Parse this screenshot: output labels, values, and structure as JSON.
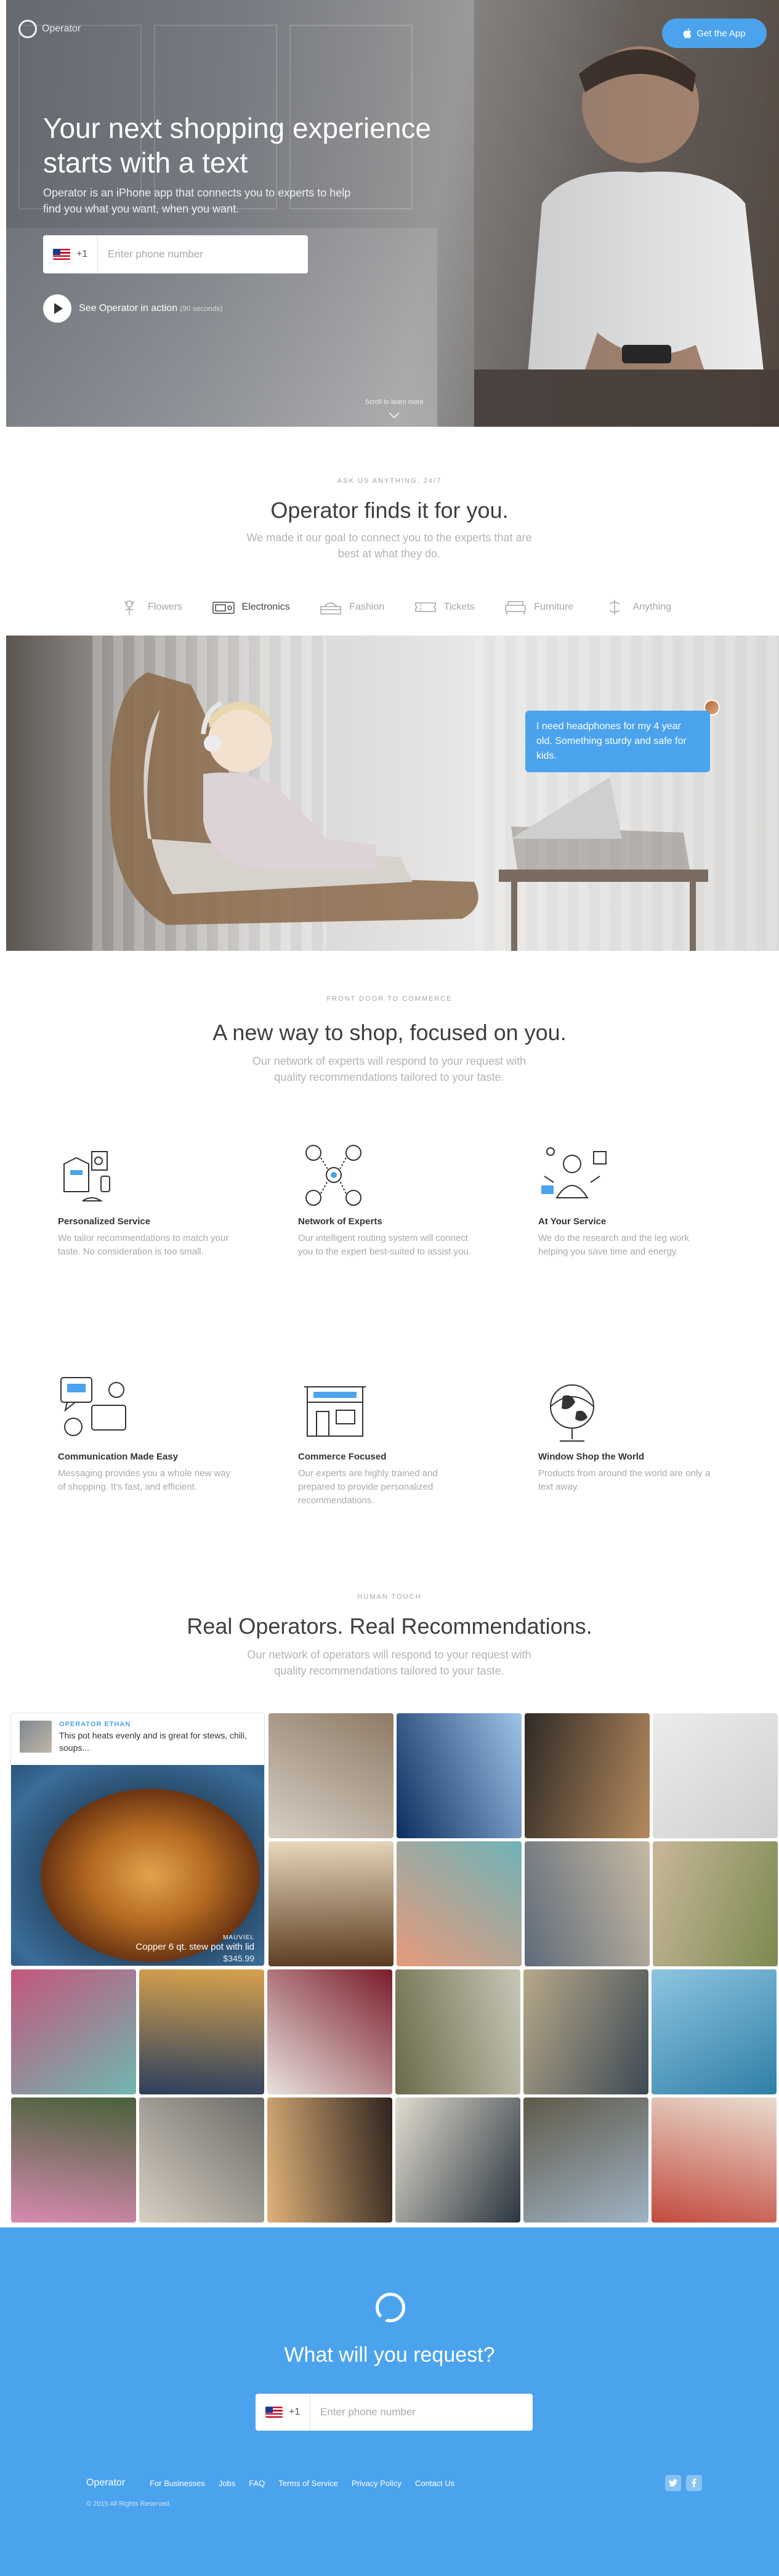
{
  "header": {
    "logo_text": "Operator",
    "get_app_label": "Get the App"
  },
  "hero": {
    "title": "Your next shopping experience starts with a text",
    "subtitle": "Operator is an iPhone app that connects you to experts to help find you what you want, when you want.",
    "country_code": "+1",
    "phone_placeholder": "Enter phone number",
    "video_label": "See Operator in action",
    "video_duration": "(90 seconds)",
    "scroll_label": "Scroll to learn more"
  },
  "finds": {
    "eyebrow": "ASK US ANYTHING, 24/7",
    "title": "Operator finds it for you.",
    "subtitle": "We made it our goal to connect you to the experts that are best at what they do.",
    "categories": [
      {
        "label": "Flowers",
        "icon": "flowers-icon",
        "active": false
      },
      {
        "label": "Electronics",
        "icon": "electronics-icon",
        "active": true
      },
      {
        "label": "Fashion",
        "icon": "fashion-icon",
        "active": false
      },
      {
        "label": "Tickets",
        "icon": "tickets-icon",
        "active": false
      },
      {
        "label": "Furniture",
        "icon": "furniture-icon",
        "active": false
      },
      {
        "label": "Anything",
        "icon": "anything-icon",
        "active": false
      }
    ],
    "chat_message": "I need headphones for my 4 year old. Something sturdy and safe for kids."
  },
  "features": {
    "eyebrow": "FRONT DOOR TO COMMERCE",
    "title": "A new way to shop, focused on you.",
    "subtitle": "Our network of experts will respond to your request with quality recommendations tailored to your taste.",
    "items": [
      {
        "title": "Personalized Service",
        "body": "We tailor recommendations to match your taste. No consideration is too small.",
        "icon": "personalized-service-icon"
      },
      {
        "title": "Network of Experts",
        "body": "Our intelligent routing system will connect you to the expert best-suited to assist you.",
        "icon": "network-of-experts-icon"
      },
      {
        "title": "At Your Service",
        "body": "We do the research and the leg work helping you save time and energy.",
        "icon": "at-your-service-icon"
      },
      {
        "title": "Communication Made Easy",
        "body": "Messaging provides you a whole new way of shopping. It's fast, and efficient.",
        "icon": "communication-icon"
      },
      {
        "title": "Commerce Focused",
        "body": "Our experts are highly trained and prepared to provide personalized recommendations.",
        "icon": "commerce-focused-icon"
      },
      {
        "title": "Window Shop the World",
        "body": "Products from around the world are only a text away.",
        "icon": "globe-icon"
      }
    ]
  },
  "operators": {
    "eyebrow": "HUMAN TOUCH",
    "title": "Real Operators. Real Recommendations.",
    "subtitle": "Our network of operators will respond to your request with quality recommendations tailored to your taste.",
    "card": {
      "operator_name": "OPERATOR ETHAN",
      "quote": "This pot heats evenly and is great for stews, chili, soups...",
      "brand": "MAUVIEL",
      "product": "Copper 6 qt. stew pot with lid",
      "price": "$345.99"
    },
    "tiles": [
      {
        "colors": [
          "#d7cfc4",
          "#8d7a66"
        ]
      },
      {
        "colors": [
          "#0c2e5e",
          "#9ec3e8"
        ]
      },
      {
        "colors": [
          "#2f2a26",
          "#b58a5e"
        ]
      },
      {
        "colors": [
          "#ececec",
          "#cfcfcf"
        ]
      },
      {
        "colors": [
          "#e8d9bd",
          "#5b3a1e"
        ]
      },
      {
        "colors": [
          "#6fb3b8",
          "#e79a7b"
        ]
      },
      {
        "colors": [
          "#c7b9a3",
          "#5e6b7a"
        ]
      },
      {
        "colors": [
          "#7c8a4f",
          "#c8b79a"
        ]
      },
      {
        "colors": [
          "#6fb7b0",
          "#c4567d"
        ]
      },
      {
        "colors": [
          "#2c3f5e",
          "#d6a24c"
        ]
      },
      {
        "colors": [
          "#e8e2de",
          "#7b1d2a"
        ]
      },
      {
        "colors": [
          "#6b6a4a",
          "#c7c7b7"
        ]
      },
      {
        "colors": [
          "#b7a889",
          "#3d4a55"
        ]
      },
      {
        "colors": [
          "#8ec5e0",
          "#2f7fa6"
        ]
      },
      {
        "colors": [
          "#48613a",
          "#d78ab0"
        ]
      },
      {
        "colors": [
          "#6b6a66",
          "#d7cfc2"
        ]
      },
      {
        "colors": [
          "#2f241e",
          "#e0b27a"
        ]
      },
      {
        "colors": [
          "#2b3640",
          "#e1dccf"
        ]
      },
      {
        "colors": [
          "#9fb3c4",
          "#5f5a4a"
        ]
      },
      {
        "colors": [
          "#c44a3f",
          "#e8ddcf"
        ]
      }
    ]
  },
  "cta": {
    "title": "What will you request?",
    "country_code": "+1",
    "phone_placeholder": "Enter phone number"
  },
  "footer": {
    "brand": "Operator",
    "links": [
      "For Businesses",
      "Jobs",
      "FAQ",
      "Terms of Service",
      "Privacy Policy",
      "Contact Us"
    ],
    "social": [
      "twitter-icon",
      "facebook-icon"
    ],
    "copyright": "© 2015 All Rights Reserved."
  },
  "colors": {
    "accent": "#4ba3ee",
    "text_dark": "#3f3f3f",
    "text_muted": "#a9a9a9"
  }
}
